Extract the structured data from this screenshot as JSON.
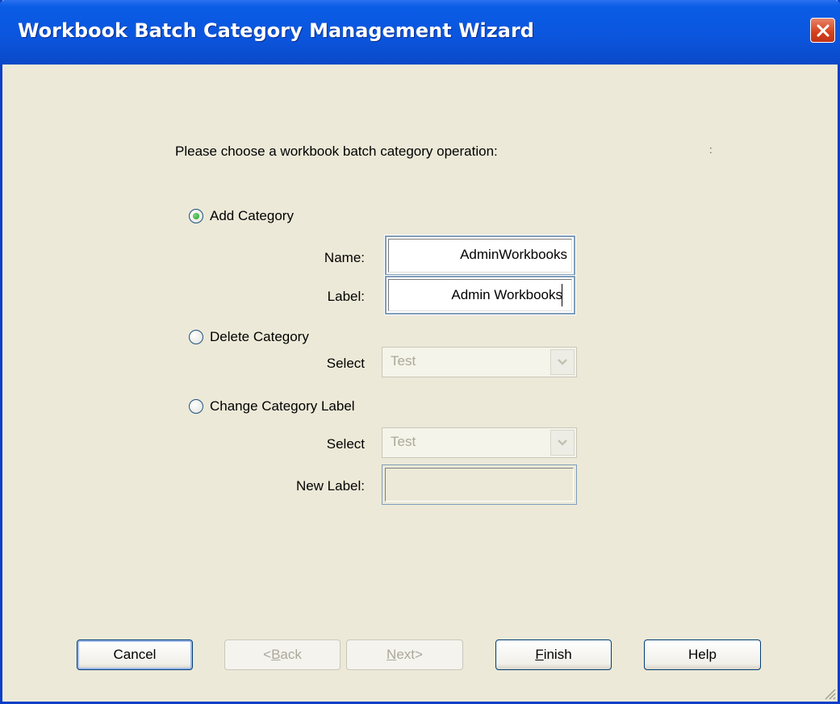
{
  "window": {
    "title": "Workbook Batch Category Management Wizard",
    "close_icon": "close-icon"
  },
  "prompt": {
    "text": "Please choose a workbook batch category operation:",
    "tail": ":"
  },
  "add_category": {
    "label": "Add Category",
    "selected": true,
    "name_label": "Name:",
    "name_value": "AdminWorkbooks",
    "label_label": "Label:",
    "label_value": "Admin Workbooks"
  },
  "delete_category": {
    "label": "Delete Category",
    "selected": false,
    "select_label": "Select",
    "select_value": "Test"
  },
  "change_label": {
    "label": "Change Category Label",
    "selected": false,
    "select_label": "Select",
    "select_value": "Test",
    "new_label_label": "New Label:",
    "new_label_value": ""
  },
  "buttons": {
    "cancel": "Cancel",
    "back_mnemonic": "B",
    "back_rest": "ack",
    "back_prefix": "<",
    "next_mnemonic": "N",
    "next_rest": "ext>",
    "finish_mnemonic": "F",
    "finish_rest": "inish",
    "help": "Help"
  },
  "colors": {
    "titlebar": "#0A5CE6",
    "dialog_bg": "#ECE9D8",
    "close_red": "#D4401B",
    "disabled_text": "#ACA899"
  }
}
